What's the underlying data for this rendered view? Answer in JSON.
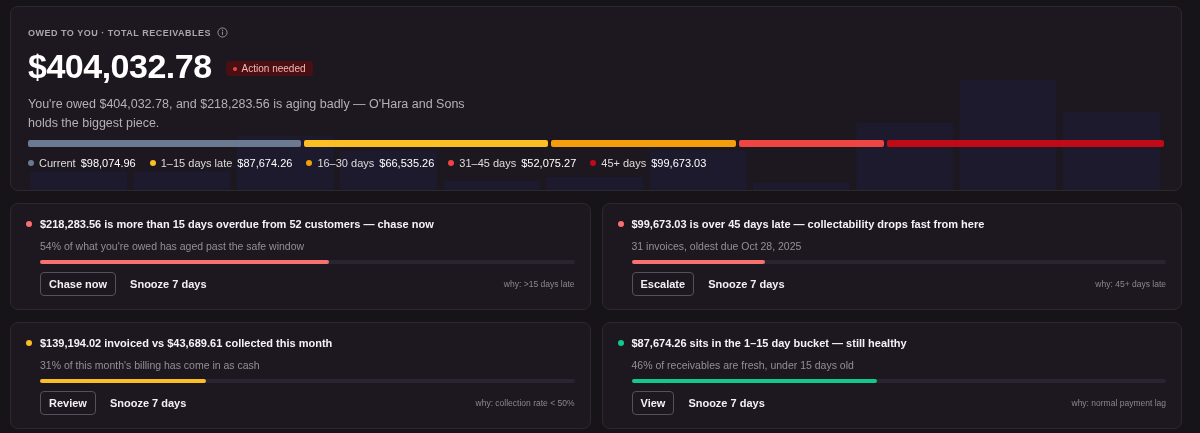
{
  "summary": {
    "eyebrow": "OWED TO YOU · TOTAL RECEIVABLES",
    "total": "$404,032.78",
    "badge": {
      "label": "Action needed",
      "color": "#ef4444"
    },
    "sentence": "You're owed $404,032.78, and $218,283.56 is aging badly — O'Hara and Sons holds the biggest piece.",
    "buckets": [
      {
        "label": "Current",
        "amount": "$98,074.96",
        "color": "#6b7a90"
      },
      {
        "label": "1–15 days late",
        "amount": "$87,674.26",
        "color": "#fbbf24"
      },
      {
        "label": "16–30 days",
        "amount": "$66,535.26",
        "color": "#f59e0b"
      },
      {
        "label": "31–45 days",
        "amount": "$52,075.27",
        "color": "#ef4444"
      },
      {
        "label": "45+ days",
        "amount": "$99,673.03",
        "color": "#c00a17"
      }
    ]
  },
  "insights": [
    {
      "title": "$218,283.56 is more than 15 days overdue from 52 customers — chase now",
      "detail": "54% of what you're owed has aged past the safe window",
      "color": "#f87171",
      "level": 0.54,
      "action": "Chase now",
      "snooze": "Snooze 7 days",
      "reason": "why: >15 days late"
    },
    {
      "title": "$99,673.03 is over 45 days late — collectability drops fast from here",
      "detail": "31 invoices, oldest due Oct 28, 2025",
      "color": "#f87171",
      "level": 0.25,
      "action": "Escalate",
      "snooze": "Snooze 7 days",
      "reason": "why: 45+ days late"
    },
    {
      "title": "$139,194.02 invoiced vs $43,689.61 collected this month",
      "detail": "31% of this month's billing has come in as cash",
      "color": "#fbbf24",
      "level": 0.31,
      "action": "Review",
      "snooze": "Snooze 7 days",
      "reason": "why: collection rate < 50%"
    },
    {
      "title": "$87,674.26 sits in the 1–15 day bucket — still healthy",
      "detail": "46% of receivables are fresh, under 15 days old",
      "color": "#10c98a",
      "level": 0.46,
      "action": "View",
      "snooze": "Snooze 7 days",
      "reason": "why: normal payment lag"
    }
  ]
}
